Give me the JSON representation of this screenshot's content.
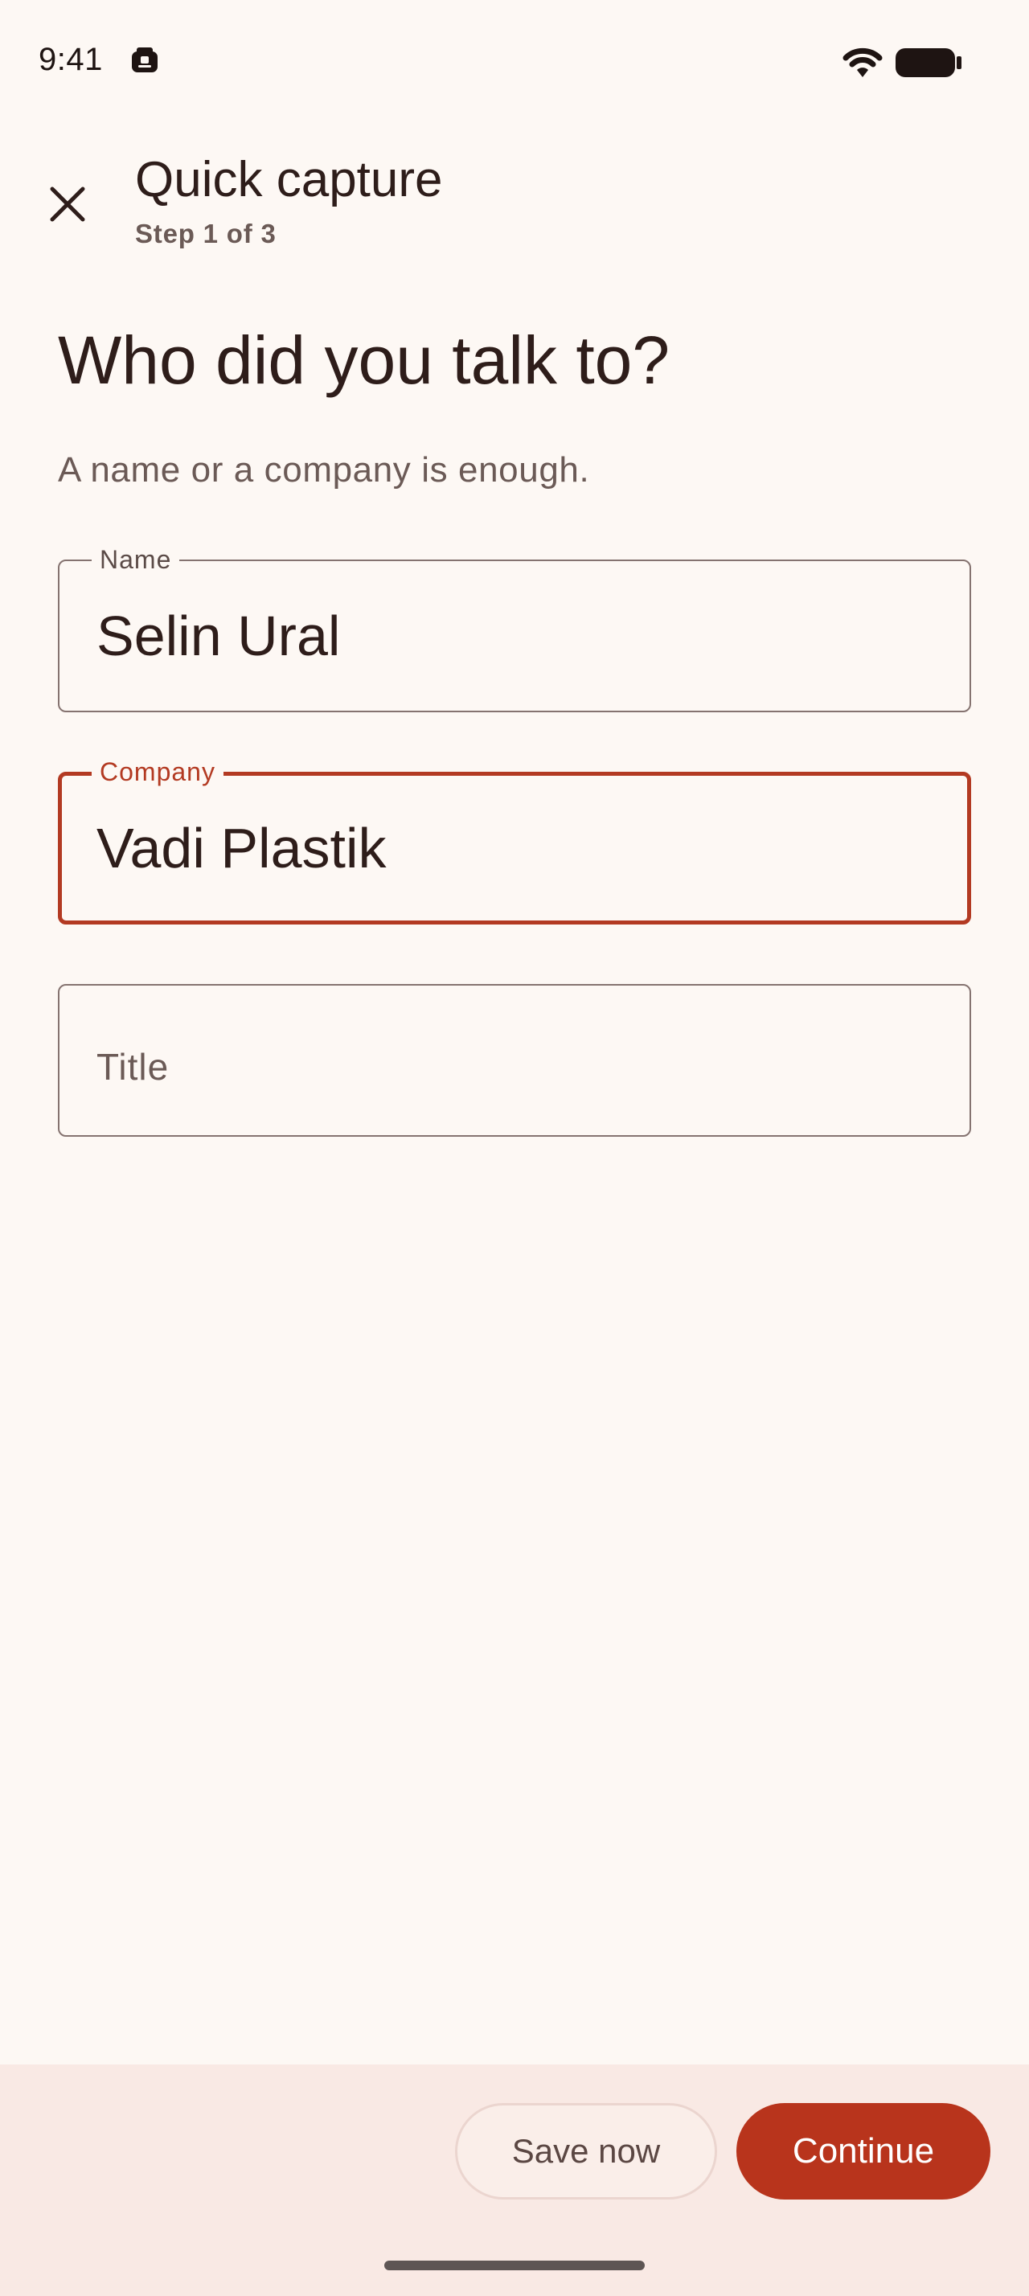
{
  "status_bar": {
    "time": "9:41",
    "icons": [
      "app-notification-icon",
      "wifi-icon",
      "battery-icon"
    ]
  },
  "app_bar": {
    "close_icon": "close-icon",
    "title": "Quick capture",
    "subtitle": "Step 1 of 3"
  },
  "content": {
    "headline": "Who did you talk to?",
    "helper": "A name or a company is enough."
  },
  "form": {
    "name": {
      "label": "Name",
      "value": "Selin Ural"
    },
    "company": {
      "label": "Company",
      "value": "Vadi Plastik",
      "focused": true
    },
    "title": {
      "placeholder": "Title",
      "value": ""
    }
  },
  "actions": {
    "save_label": "Save now",
    "continue_label": "Continue"
  },
  "colors": {
    "background": "#FDF8F4",
    "accent": "#B8341C",
    "bottom_bar": "#F9E9E4",
    "outline": "#857370"
  }
}
